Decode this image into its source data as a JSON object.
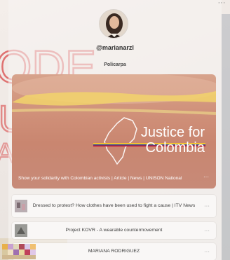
{
  "profile": {
    "handle": "@marianarzl",
    "bio": "Policarpa"
  },
  "menu": {
    "more_label": "···"
  },
  "featured": {
    "title_line1": "Justice for",
    "title_line2": "Colombia",
    "caption": "Show your solidarity with Colombian activists | Article | News | UNISON National",
    "more_label": "···"
  },
  "links": [
    {
      "text": "Dressed to protest? How clothes have been used to fight a cause | ITV News",
      "more_label": "···"
    },
    {
      "text": "Project KOVR - A wearable countermovement",
      "more_label": "···"
    },
    {
      "text": "MARIANA RODRIGUEZ",
      "more_label": "···"
    }
  ],
  "background_text": {
    "word": "ODE",
    "line2": "U",
    "line3": "A"
  },
  "colors": {
    "accent_red": "#d94a4a",
    "featured_bg": "#cf8f78",
    "flag_yellow": "#f2c230",
    "flag_blue": "#2f4fa0",
    "flag_red": "#c8102e"
  }
}
